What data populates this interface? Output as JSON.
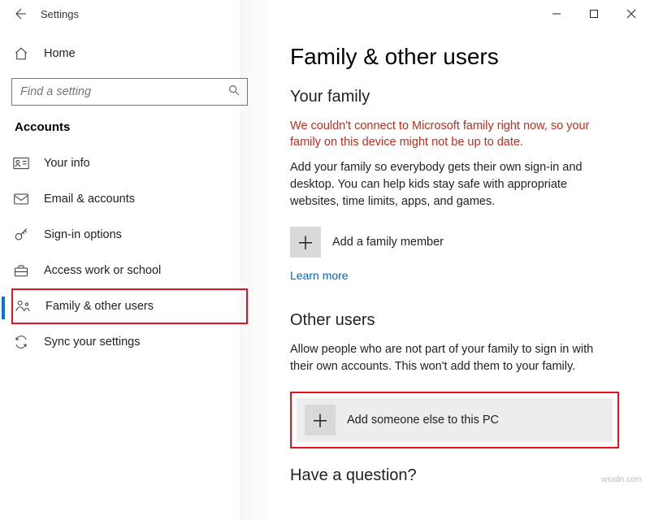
{
  "window": {
    "title": "Settings"
  },
  "sidebar": {
    "home_label": "Home",
    "search_placeholder": "Find a setting",
    "section": "Accounts",
    "items": [
      {
        "label": "Your info"
      },
      {
        "label": "Email & accounts"
      },
      {
        "label": "Sign-in options"
      },
      {
        "label": "Access work or school"
      },
      {
        "label": "Family & other users"
      },
      {
        "label": "Sync your settings"
      }
    ]
  },
  "main": {
    "page_title": "Family & other users",
    "family": {
      "heading": "Your family",
      "error": "We couldn't connect to Microsoft family right now, so your family on this device might not be up to date.",
      "body": "Add your family so everybody gets their own sign-in and desktop. You can help kids stay safe with appropriate websites, time limits, apps, and games.",
      "add_label": "Add a family member",
      "learn_more": "Learn more"
    },
    "other": {
      "heading": "Other users",
      "body": "Allow people who are not part of your family to sign in with their own accounts. This won't add them to your family.",
      "add_label": "Add someone else to this PC"
    },
    "question_heading": "Have a question?"
  },
  "watermark": "wsxdn.com"
}
